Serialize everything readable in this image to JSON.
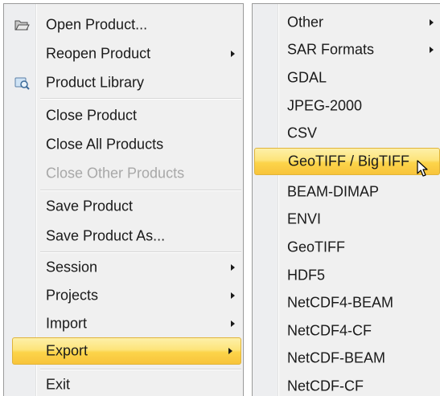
{
  "file_menu": {
    "items": [
      {
        "label": "Open Product...",
        "icon": "folder-open-icon"
      },
      {
        "label": "Reopen Product",
        "submenu": true
      },
      {
        "label": "Product Library",
        "icon": "product-library-icon"
      },
      {
        "label": "Close Product"
      },
      {
        "label": "Close All Products"
      },
      {
        "label": "Close Other Products",
        "disabled": true
      },
      {
        "label": "Save Product"
      },
      {
        "label": "Save Product As..."
      },
      {
        "label": "Session",
        "submenu": true
      },
      {
        "label": "Projects",
        "submenu": true
      },
      {
        "label": "Import",
        "submenu": true
      },
      {
        "label": "Export",
        "submenu": true,
        "highlighted": true
      },
      {
        "label": "Exit"
      }
    ]
  },
  "export_menu": {
    "items": [
      {
        "label": "Other",
        "submenu": true
      },
      {
        "label": "SAR Formats",
        "submenu": true
      },
      {
        "label": "GDAL"
      },
      {
        "label": "JPEG-2000"
      },
      {
        "label": "CSV"
      },
      {
        "label": "GeoTIFF / BigTIFF",
        "highlighted": true
      },
      {
        "label": "BEAM-DIMAP"
      },
      {
        "label": "ENVI"
      },
      {
        "label": "GeoTIFF"
      },
      {
        "label": "HDF5"
      },
      {
        "label": "NetCDF4-BEAM"
      },
      {
        "label": "NetCDF4-CF"
      },
      {
        "label": "NetCDF-BEAM"
      },
      {
        "label": "NetCDF-CF"
      }
    ]
  },
  "colors": {
    "highlight": "#fcd44a",
    "menu_bg": "#f0f0f0",
    "disabled_text": "#a8a8a8"
  }
}
